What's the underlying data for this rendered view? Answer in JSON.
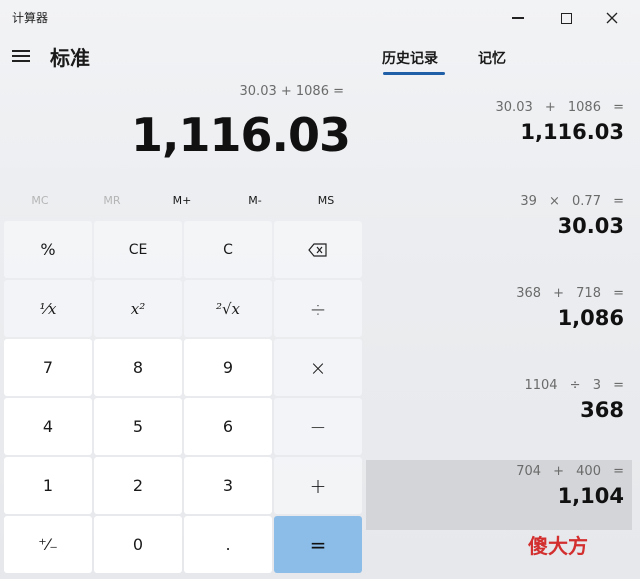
{
  "app": {
    "title": "计算器",
    "mode": "标准"
  },
  "window_controls": {
    "minimize": "—",
    "maximize": "□",
    "close": "✕"
  },
  "display": {
    "expression": "30.03 + 1086 =",
    "result": "1,116.03"
  },
  "memory": {
    "mc": "MC",
    "mr": "MR",
    "mplus": "M+",
    "mminus": "M-",
    "ms": "MS"
  },
  "keys": {
    "percent": "%",
    "ce": "CE",
    "c": "C",
    "backspace": "⌫",
    "reciprocal": "¹⁄x",
    "square": "x²",
    "sqrt": "²√x",
    "divide": "÷",
    "seven": "7",
    "eight": "8",
    "nine": "9",
    "multiply": "×",
    "four": "4",
    "five": "5",
    "six": "6",
    "minus": "−",
    "one": "1",
    "two": "2",
    "three": "3",
    "plus": "+",
    "negate": "⁺⁄₋",
    "zero": "0",
    "decimal": ".",
    "equals": "="
  },
  "tabs": {
    "history": "历史记录",
    "memory": "记忆"
  },
  "history": [
    {
      "expression": "30.03 + 1086 =",
      "result": "1,116.03"
    },
    {
      "expression": "39 × 0.77 =",
      "result": "30.03"
    },
    {
      "expression": "368 + 718 =",
      "result": "1,086"
    },
    {
      "expression": "1104 ÷ 3 =",
      "result": "368"
    },
    {
      "expression": "704 + 400 =",
      "result": "1,104"
    }
  ],
  "watermark": {
    "text": "傻大方"
  },
  "colors": {
    "accent": "#1f5fa8",
    "equals_key": "#8cbde8",
    "selected_history": "#d3d5d8"
  }
}
